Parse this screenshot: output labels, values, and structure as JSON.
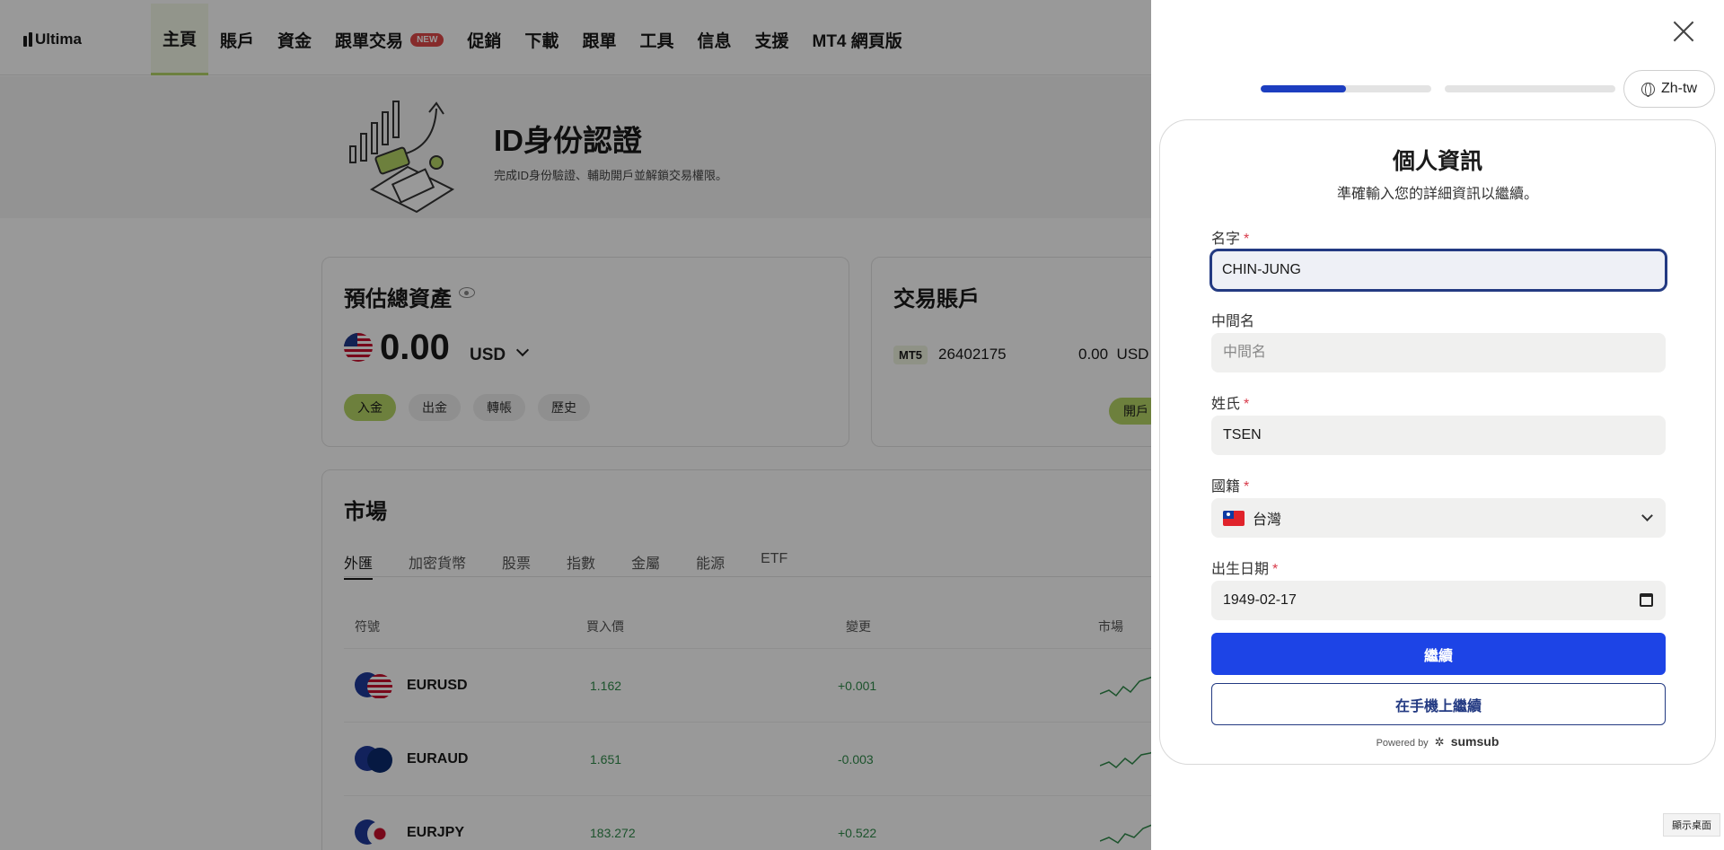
{
  "brand": {
    "name": "Ultima"
  },
  "nav": {
    "items": [
      {
        "label": "主頁",
        "active": true
      },
      {
        "label": "賬戶"
      },
      {
        "label": "資金"
      },
      {
        "label": "跟單交易",
        "badge": "NEW"
      },
      {
        "label": "促銷"
      },
      {
        "label": "下載"
      },
      {
        "label": "跟單"
      },
      {
        "label": "工具"
      },
      {
        "label": "信息"
      },
      {
        "label": "支援"
      },
      {
        "label": "MT4 網頁版"
      }
    ]
  },
  "hero": {
    "title": "ID身份認證",
    "subtitle": "完成ID身份驗證、輔助開戶並解鎖交易權限。"
  },
  "assets": {
    "title": "預估總資產",
    "amount": "0.00",
    "currency": "USD",
    "actions": [
      "入金",
      "出金",
      "轉帳",
      "歷史"
    ]
  },
  "trading_account": {
    "title": "交易賬戶",
    "platform": "MT5",
    "account_number": "26402175",
    "balance": "0.00",
    "currency": "USD",
    "open_button": "開戶"
  },
  "market": {
    "title": "市場",
    "tabs": [
      "外匯",
      "加密貨幣",
      "股票",
      "指數",
      "金屬",
      "能源",
      "ETF"
    ],
    "columns": [
      "符號",
      "買入價",
      "變更",
      "市場"
    ],
    "rows": [
      {
        "symbol": "EURUSD",
        "bid": "1.162",
        "change": "+0.001"
      },
      {
        "symbol": "EURAUD",
        "bid": "1.651",
        "change": "-0.003"
      },
      {
        "symbol": "EURJPY",
        "bid": "183.272",
        "change": "+0.522"
      }
    ]
  },
  "kyc": {
    "language": "Zh-tw",
    "progress_steps": [
      0.5,
      0
    ],
    "title": "個人資訊",
    "subtitle": "準確輸入您的詳細資訊以繼續。",
    "fields": {
      "first_name": {
        "label": "名字",
        "value": "CHIN-JUNG",
        "required": true
      },
      "middle_name": {
        "label": "中間名",
        "value": "",
        "placeholder": "中間名",
        "required": false
      },
      "last_name": {
        "label": "姓氏",
        "value": "TSEN",
        "required": true
      },
      "nationality": {
        "label": "國籍",
        "value": "台灣",
        "required": true
      },
      "dob": {
        "label": "出生日期",
        "value": "1949-02-17",
        "required": true
      }
    },
    "continue_button": "繼續",
    "mobile_button": "在手機上繼續",
    "powered_by": "Powered by",
    "powered_brand": "sumsub"
  },
  "taskbar": {
    "show_desktop": "顯示桌面"
  },
  "colors": {
    "accent_green": "#b6d567",
    "primary_blue": "#1d44e6",
    "navy": "#233a82",
    "required_red": "#d83a4a",
    "positive": "#2f8a4a"
  }
}
